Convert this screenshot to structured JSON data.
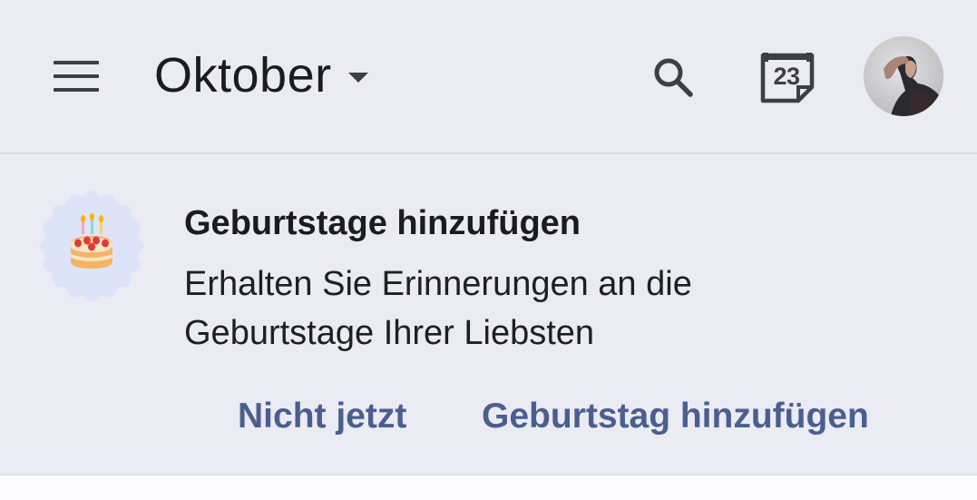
{
  "header": {
    "month_label": "Oktober",
    "today_date": "23",
    "icons": {
      "menu": "hamburger-menu-icon",
      "caret": "dropdown-caret-icon",
      "search": "search-icon",
      "today": "calendar-today-icon",
      "avatar": "user-avatar"
    }
  },
  "banner": {
    "icon": "birthday-cake-icon",
    "title": "Geburtstage hinzufügen",
    "description_line1": "Erhalten Sie Erinnerungen an die",
    "description_line2": "Geburtstage Ihrer Liebsten",
    "dismiss_label": "Nicht jetzt",
    "action_label": "Geburtstag hinzufügen"
  },
  "colors": {
    "background": "#eaebf3",
    "action_text": "#4a5f8f",
    "primary_text": "#1c1b1f",
    "badge": "#dde3f8"
  }
}
